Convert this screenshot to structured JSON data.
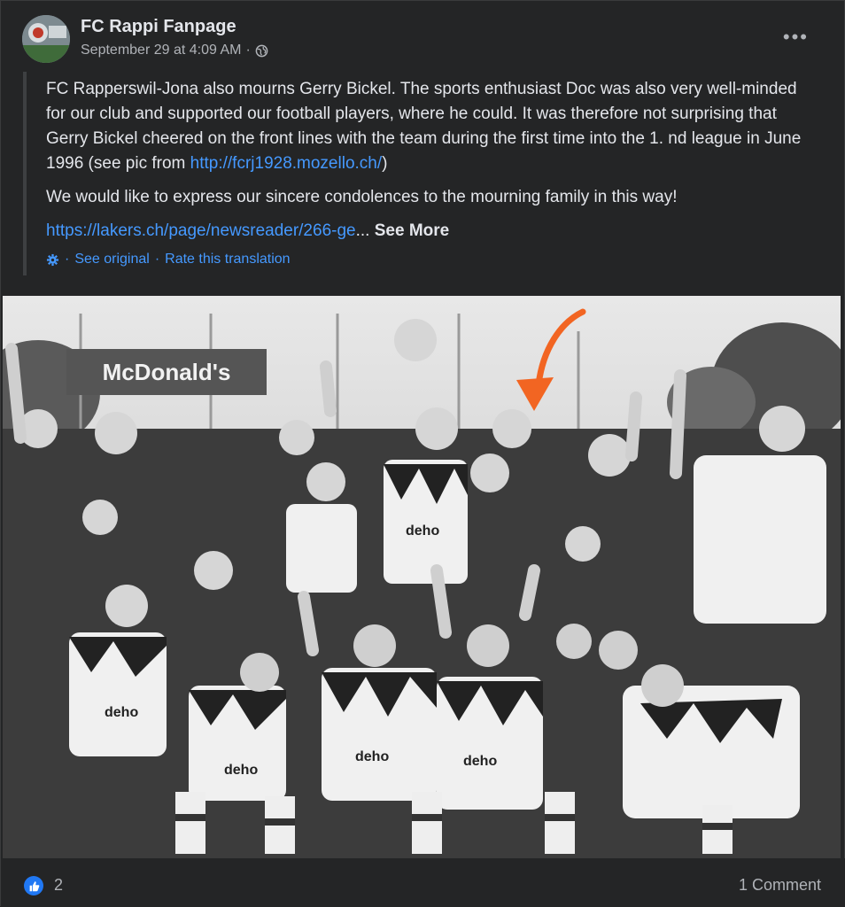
{
  "header": {
    "page_name": "FC Rappi Fanpage",
    "timestamp": "September 29 at 4:09 AM",
    "separator": "·",
    "audience_icon": "globe-icon",
    "more_label": "•••"
  },
  "post": {
    "paragraph1_text": "FC Rapperswil-Jona also mourns Gerry Bickel. The sports enthusiast Doc was also very well-minded for our club and supported our football players, where he could. It was therefore not surprising that Gerry Bickel cheered on the front lines with the team during the first time into the 1. nd league in June 1996 (see pic from ",
    "paragraph1_link": "http://fcrj1928.mozello.ch/",
    "paragraph1_close": ")",
    "paragraph2": "We would like to express our sincere condolences to the mourning family in this way!",
    "truncated_link": "https://lakers.ch/page/newsreader/266-ge",
    "ellipsis": "...",
    "see_more": "See More"
  },
  "translation": {
    "icon": "gear-icon",
    "see_original": "See original",
    "sep": "·",
    "rate": "Rate this translation"
  },
  "photo": {
    "sign_text": "McDonald's",
    "shirt_text": "deho",
    "arrow_color": "#f26522"
  },
  "footer": {
    "like_icon": "thumbs-up-icon",
    "like_count": "2",
    "comment_count": "1 Comment"
  },
  "colors": {
    "background": "#242526",
    "text": "#e4e6eb",
    "secondary": "#b0b3b8",
    "link": "#4599ff",
    "like_blue": "#2078f4"
  }
}
